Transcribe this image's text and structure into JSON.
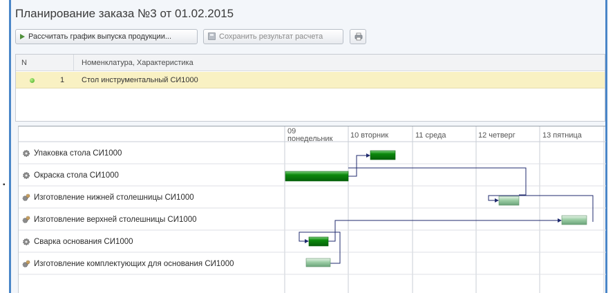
{
  "title": "Планирование заказа №3 от 01.02.2015",
  "toolbar": {
    "calculate_label": "Рассчитать график выпуска продукции...",
    "save_result_label": "Сохранить результат расчета",
    "print_icon": "printer-icon"
  },
  "products_table": {
    "columns": [
      "N",
      "Номенклатура, Характеристика"
    ],
    "rows": [
      {
        "status": "green-dot",
        "n": "1",
        "name": "Стол инструментальный СИ1000"
      }
    ]
  },
  "gantt": {
    "days": [
      "09 понедельник",
      "10 вторник",
      "11 среда",
      "12 четверг",
      "13 пятница"
    ],
    "tasks": [
      {
        "name": "Упаковка стола СИ1000",
        "icon": "gear-icon"
      },
      {
        "name": "Окраска стола СИ1000",
        "icon": "gear-icon"
      },
      {
        "name": "Изготовление нижней столешницы СИ1000",
        "icon": "gears-icon"
      },
      {
        "name": "Изготовление верхней столешницы СИ1000",
        "icon": "gears-icon"
      },
      {
        "name": "Сварка основания СИ1000",
        "icon": "gear-icon"
      },
      {
        "name": "Изготовление комплектующих для основания СИ1000",
        "icon": "gears-icon"
      }
    ]
  },
  "colors": {
    "frame_blue": "#4a86c8",
    "bar_dark_green": "#0c8a0c",
    "bar_light_green": "#8fc79b",
    "selected_row": "#f9f1c3",
    "connector": "#1f2a6e"
  }
}
